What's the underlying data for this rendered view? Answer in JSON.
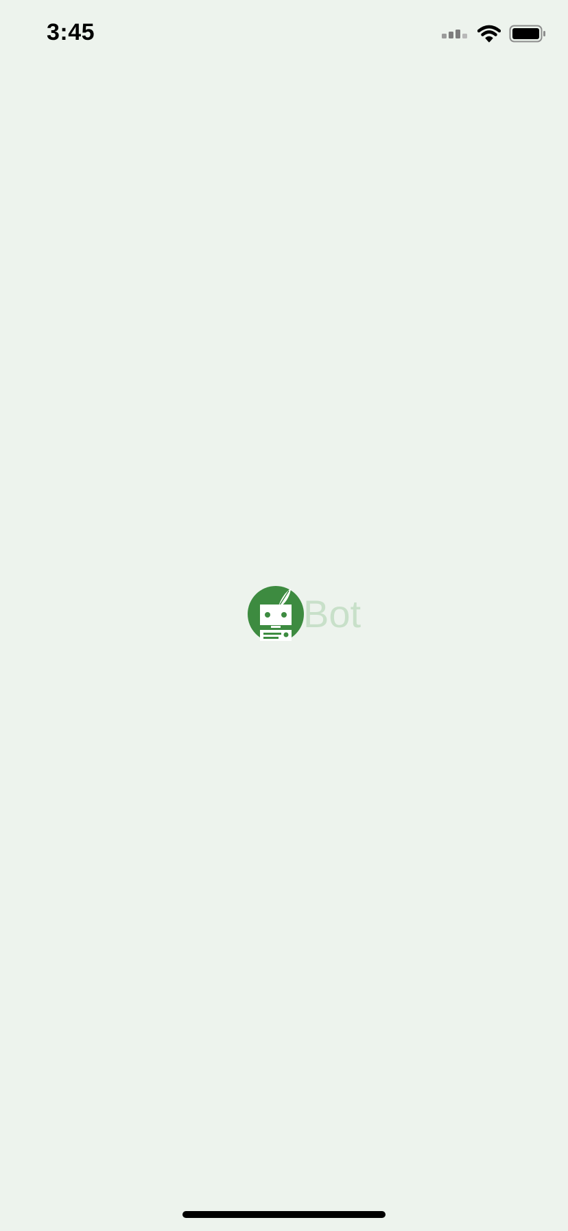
{
  "status_bar": {
    "time": "3:45",
    "icons": [
      "signal-icon",
      "wifi-icon",
      "battery-icon"
    ]
  },
  "splash": {
    "logo_icon": "robot-quill-icon",
    "logo_text": "Bot"
  },
  "colors": {
    "background": "#edf3ed",
    "brand_green": "#3d8b40",
    "logo_text": "#c8e0c9"
  }
}
